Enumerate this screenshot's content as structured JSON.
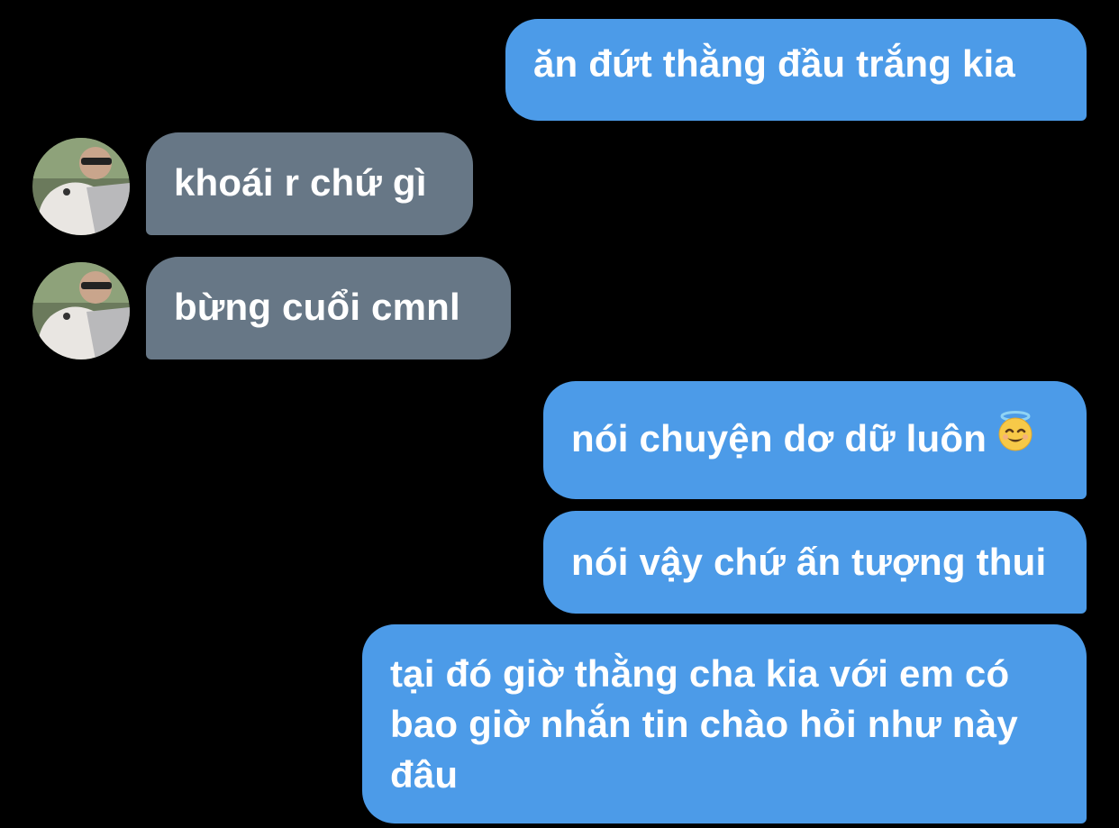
{
  "messages": [
    {
      "side": "outgoing",
      "text": "ăn đứt thằng đầu trắng kia"
    },
    {
      "side": "incoming",
      "text": "khoái r chứ gì"
    },
    {
      "side": "incoming",
      "text": "bừng cuổi cmnl"
    },
    {
      "side": "outgoing",
      "text": "nói chuyện dơ dữ luôn",
      "emoji": "smiling-face-with-halo"
    },
    {
      "side": "outgoing",
      "text": "nói vậy chứ ấn tượng thui"
    },
    {
      "side": "outgoing",
      "text": "tại đó giờ thằng cha kia với em có bao giờ nhắn tin chào hỏi như này đâu"
    }
  ],
  "colors": {
    "background": "#000000",
    "outgoing_bubble": "#4c9be8",
    "incoming_bubble": "#677786",
    "text": "#ffffff"
  }
}
